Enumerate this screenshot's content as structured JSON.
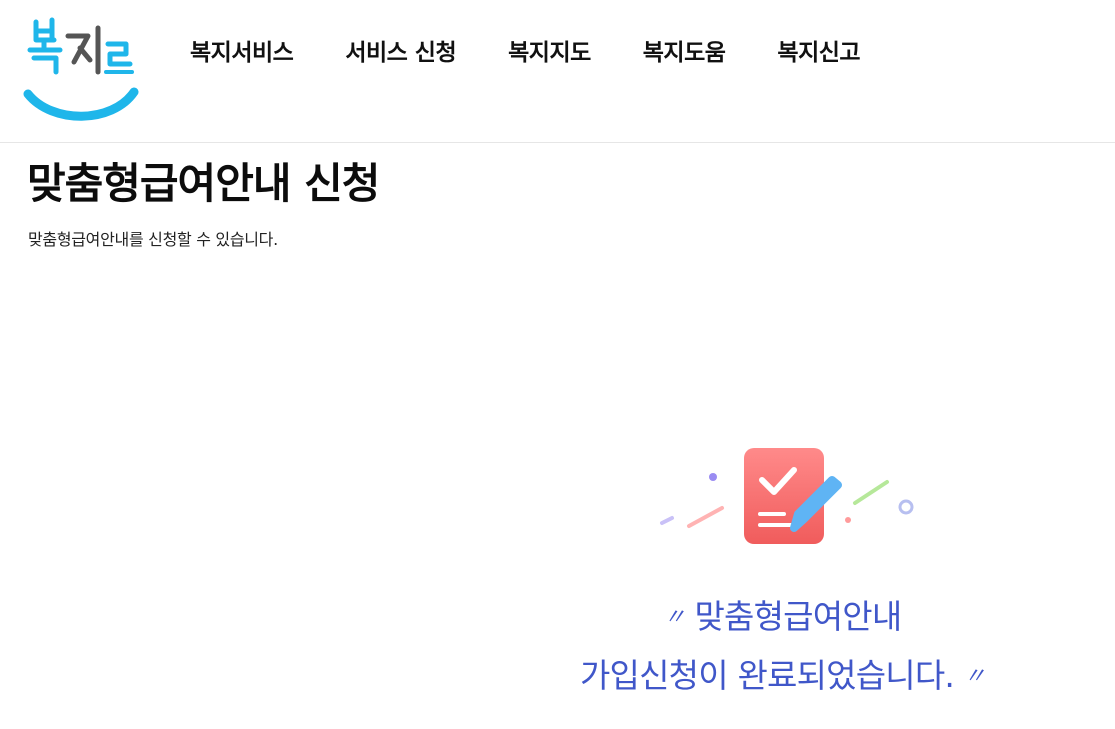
{
  "brand": {
    "logo_text": "복지로",
    "logo_color": "#1fb6ea",
    "logo_text_color": "#555555"
  },
  "nav": {
    "items": [
      {
        "label": "복지서비스"
      },
      {
        "label": "서비스 신청"
      },
      {
        "label": "복지지도"
      },
      {
        "label": "복지도움"
      },
      {
        "label": "복지신고"
      }
    ]
  },
  "page": {
    "title": "맞춤형급여안내 신청",
    "description": "맞춤형급여안내를 신청할 수 있습니다."
  },
  "completion": {
    "icon": "document-check-pencil-icon",
    "quote_open": "〃",
    "line1": "맞춤형급여안내",
    "line2": "가입신청이 완료되었습니다.",
    "quote_close": "〃",
    "accent_color": "#4057c9",
    "icon_color": "#f56b6b"
  }
}
